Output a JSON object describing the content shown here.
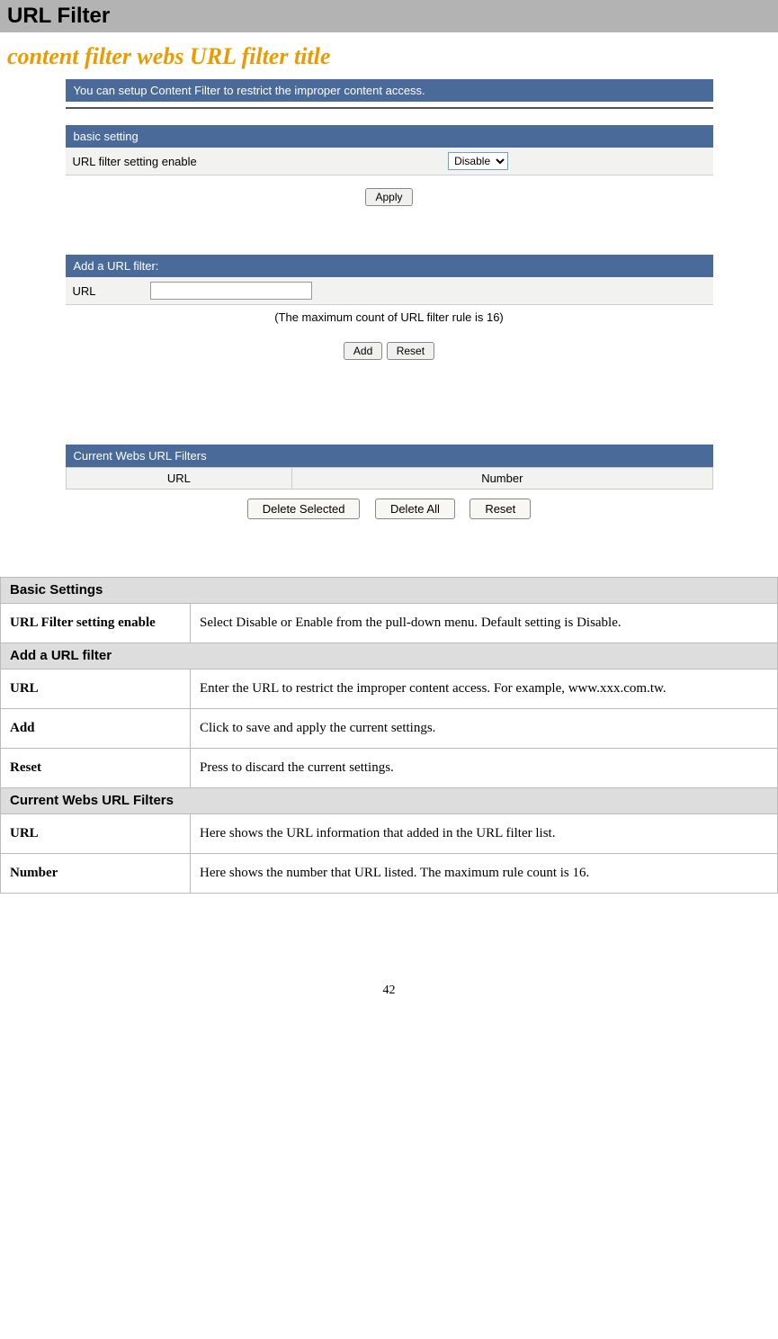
{
  "page_title": "URL Filter",
  "subtitle": "content filter webs URL filter title",
  "intro_bar": "You can setup Content Filter to restrict the improper content access.",
  "basic_setting": {
    "header": "basic setting",
    "label": "URL filter setting enable",
    "select_value": "Disable",
    "apply_btn": "Apply"
  },
  "add_filter": {
    "header": "Add a URL filter:",
    "url_label": "URL",
    "note": "(The maximum count of URL filter rule is 16)",
    "add_btn": "Add",
    "reset_btn": "Reset"
  },
  "current_filters": {
    "header": "Current Webs URL Filters",
    "col_url": "URL",
    "col_number": "Number",
    "delete_selected_btn": "Delete Selected",
    "delete_all_btn": "Delete All",
    "reset_btn": "Reset"
  },
  "help": {
    "sections": [
      {
        "title": "Basic Settings",
        "rows": [
          {
            "label": "URL Filter setting enable",
            "desc": "Select Disable or Enable from the pull-down menu. Default setting is Disable."
          }
        ]
      },
      {
        "title": "Add a URL filter",
        "rows": [
          {
            "label": "URL",
            "desc": "Enter the URL to restrict the improper content access. For example, www.xxx.com.tw."
          },
          {
            "label": "Add",
            "desc": "Click to save and apply the current settings."
          },
          {
            "label": "Reset",
            "desc": "Press to discard the current settings."
          }
        ]
      },
      {
        "title": "Current Webs URL Filters",
        "rows": [
          {
            "label": "URL",
            "desc": "Here shows the URL information that added in the URL filter list."
          },
          {
            "label": "Number",
            "desc": "Here shows the number that URL listed. The maximum rule count is 16."
          }
        ]
      }
    ]
  },
  "page_number": "42"
}
